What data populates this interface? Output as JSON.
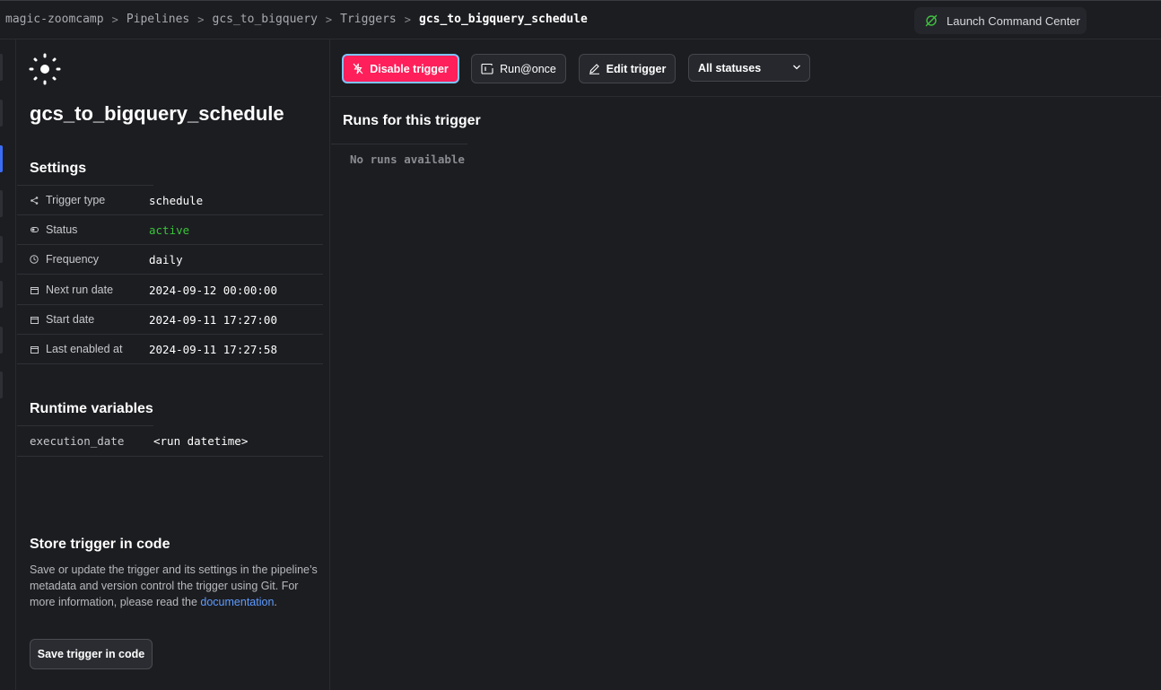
{
  "breadcrumb": [
    "magic-zoomcamp",
    "Pipelines",
    "gcs_to_bigquery",
    "Triggers",
    "gcs_to_bigquery_schedule"
  ],
  "command_center": {
    "label": "Launch Command Center",
    "icon": "rocket-icon"
  },
  "trigger": {
    "title": "gcs_to_bigquery_schedule",
    "icon": "sun-icon"
  },
  "settings": {
    "title": "Settings",
    "rows": [
      {
        "label": "Trigger type",
        "value": "schedule",
        "icon": "share-icon"
      },
      {
        "label": "Status",
        "value": "active",
        "icon": "toggle-icon"
      },
      {
        "label": "Frequency",
        "value": "daily",
        "icon": "clock-icon"
      },
      {
        "label": "Next run date",
        "value": "2024-09-12 00:00:00",
        "icon": "calendar-icon"
      },
      {
        "label": "Start date",
        "value": "2024-09-11 17:27:00",
        "icon": "calendar-icon"
      },
      {
        "label": "Last enabled at",
        "value": "2024-09-11 17:27:58",
        "icon": "calendar-icon"
      }
    ]
  },
  "runtime": {
    "title": "Runtime variables",
    "variables": [
      {
        "key": "execution_date",
        "value": "<run datetime>"
      }
    ]
  },
  "store": {
    "title": "Store trigger in code",
    "description": "Save or update the trigger and its settings in the pipeline’s metadata and version control the trigger using Git. For more information, please read the",
    "link_text": "documentation",
    "after_link": ".",
    "button_label": "Save trigger in code"
  },
  "toolbar": {
    "disable_label": "Disable trigger",
    "runonce_label": "Run@once",
    "edit_label": "Edit trigger",
    "status_filter": "All statuses"
  },
  "runs": {
    "title": "Runs for this trigger",
    "empty": "No runs available"
  },
  "colors": {
    "accent_pink": "#ff1f5a",
    "active_green": "#39c439",
    "link_blue": "#5e9bff",
    "focus_ring": "#7cc4ff"
  }
}
